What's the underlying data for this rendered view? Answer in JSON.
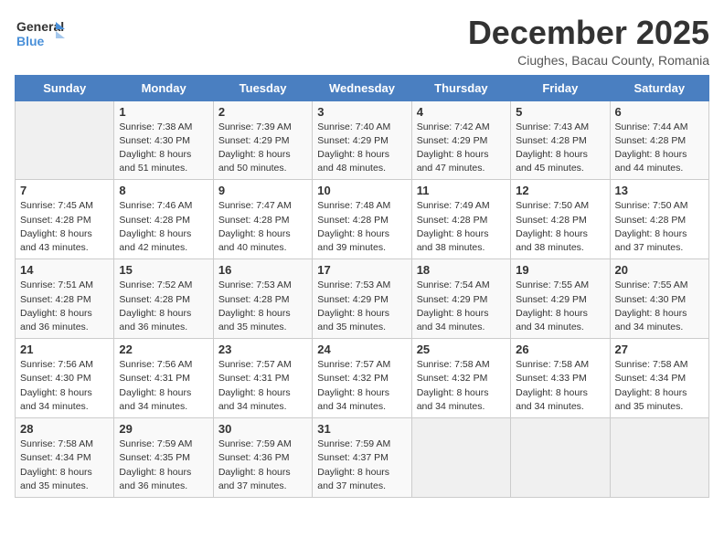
{
  "logo": {
    "general": "General",
    "blue": "Blue"
  },
  "title": "December 2025",
  "subtitle": "Ciughes, Bacau County, Romania",
  "weekdays": [
    "Sunday",
    "Monday",
    "Tuesday",
    "Wednesday",
    "Thursday",
    "Friday",
    "Saturday"
  ],
  "weeks": [
    [
      {
        "day": "",
        "info": ""
      },
      {
        "day": "1",
        "info": "Sunrise: 7:38 AM\nSunset: 4:30 PM\nDaylight: 8 hours\nand 51 minutes."
      },
      {
        "day": "2",
        "info": "Sunrise: 7:39 AM\nSunset: 4:29 PM\nDaylight: 8 hours\nand 50 minutes."
      },
      {
        "day": "3",
        "info": "Sunrise: 7:40 AM\nSunset: 4:29 PM\nDaylight: 8 hours\nand 48 minutes."
      },
      {
        "day": "4",
        "info": "Sunrise: 7:42 AM\nSunset: 4:29 PM\nDaylight: 8 hours\nand 47 minutes."
      },
      {
        "day": "5",
        "info": "Sunrise: 7:43 AM\nSunset: 4:28 PM\nDaylight: 8 hours\nand 45 minutes."
      },
      {
        "day": "6",
        "info": "Sunrise: 7:44 AM\nSunset: 4:28 PM\nDaylight: 8 hours\nand 44 minutes."
      }
    ],
    [
      {
        "day": "7",
        "info": "Sunrise: 7:45 AM\nSunset: 4:28 PM\nDaylight: 8 hours\nand 43 minutes."
      },
      {
        "day": "8",
        "info": "Sunrise: 7:46 AM\nSunset: 4:28 PM\nDaylight: 8 hours\nand 42 minutes."
      },
      {
        "day": "9",
        "info": "Sunrise: 7:47 AM\nSunset: 4:28 PM\nDaylight: 8 hours\nand 40 minutes."
      },
      {
        "day": "10",
        "info": "Sunrise: 7:48 AM\nSunset: 4:28 PM\nDaylight: 8 hours\nand 39 minutes."
      },
      {
        "day": "11",
        "info": "Sunrise: 7:49 AM\nSunset: 4:28 PM\nDaylight: 8 hours\nand 38 minutes."
      },
      {
        "day": "12",
        "info": "Sunrise: 7:50 AM\nSunset: 4:28 PM\nDaylight: 8 hours\nand 38 minutes."
      },
      {
        "day": "13",
        "info": "Sunrise: 7:50 AM\nSunset: 4:28 PM\nDaylight: 8 hours\nand 37 minutes."
      }
    ],
    [
      {
        "day": "14",
        "info": "Sunrise: 7:51 AM\nSunset: 4:28 PM\nDaylight: 8 hours\nand 36 minutes."
      },
      {
        "day": "15",
        "info": "Sunrise: 7:52 AM\nSunset: 4:28 PM\nDaylight: 8 hours\nand 36 minutes."
      },
      {
        "day": "16",
        "info": "Sunrise: 7:53 AM\nSunset: 4:28 PM\nDaylight: 8 hours\nand 35 minutes."
      },
      {
        "day": "17",
        "info": "Sunrise: 7:53 AM\nSunset: 4:29 PM\nDaylight: 8 hours\nand 35 minutes."
      },
      {
        "day": "18",
        "info": "Sunrise: 7:54 AM\nSunset: 4:29 PM\nDaylight: 8 hours\nand 34 minutes."
      },
      {
        "day": "19",
        "info": "Sunrise: 7:55 AM\nSunset: 4:29 PM\nDaylight: 8 hours\nand 34 minutes."
      },
      {
        "day": "20",
        "info": "Sunrise: 7:55 AM\nSunset: 4:30 PM\nDaylight: 8 hours\nand 34 minutes."
      }
    ],
    [
      {
        "day": "21",
        "info": "Sunrise: 7:56 AM\nSunset: 4:30 PM\nDaylight: 8 hours\nand 34 minutes."
      },
      {
        "day": "22",
        "info": "Sunrise: 7:56 AM\nSunset: 4:31 PM\nDaylight: 8 hours\nand 34 minutes."
      },
      {
        "day": "23",
        "info": "Sunrise: 7:57 AM\nSunset: 4:31 PM\nDaylight: 8 hours\nand 34 minutes."
      },
      {
        "day": "24",
        "info": "Sunrise: 7:57 AM\nSunset: 4:32 PM\nDaylight: 8 hours\nand 34 minutes."
      },
      {
        "day": "25",
        "info": "Sunrise: 7:58 AM\nSunset: 4:32 PM\nDaylight: 8 hours\nand 34 minutes."
      },
      {
        "day": "26",
        "info": "Sunrise: 7:58 AM\nSunset: 4:33 PM\nDaylight: 8 hours\nand 34 minutes."
      },
      {
        "day": "27",
        "info": "Sunrise: 7:58 AM\nSunset: 4:34 PM\nDaylight: 8 hours\nand 35 minutes."
      }
    ],
    [
      {
        "day": "28",
        "info": "Sunrise: 7:58 AM\nSunset: 4:34 PM\nDaylight: 8 hours\nand 35 minutes."
      },
      {
        "day": "29",
        "info": "Sunrise: 7:59 AM\nSunset: 4:35 PM\nDaylight: 8 hours\nand 36 minutes."
      },
      {
        "day": "30",
        "info": "Sunrise: 7:59 AM\nSunset: 4:36 PM\nDaylight: 8 hours\nand 37 minutes."
      },
      {
        "day": "31",
        "info": "Sunrise: 7:59 AM\nSunset: 4:37 PM\nDaylight: 8 hours\nand 37 minutes."
      },
      {
        "day": "",
        "info": ""
      },
      {
        "day": "",
        "info": ""
      },
      {
        "day": "",
        "info": ""
      }
    ]
  ]
}
